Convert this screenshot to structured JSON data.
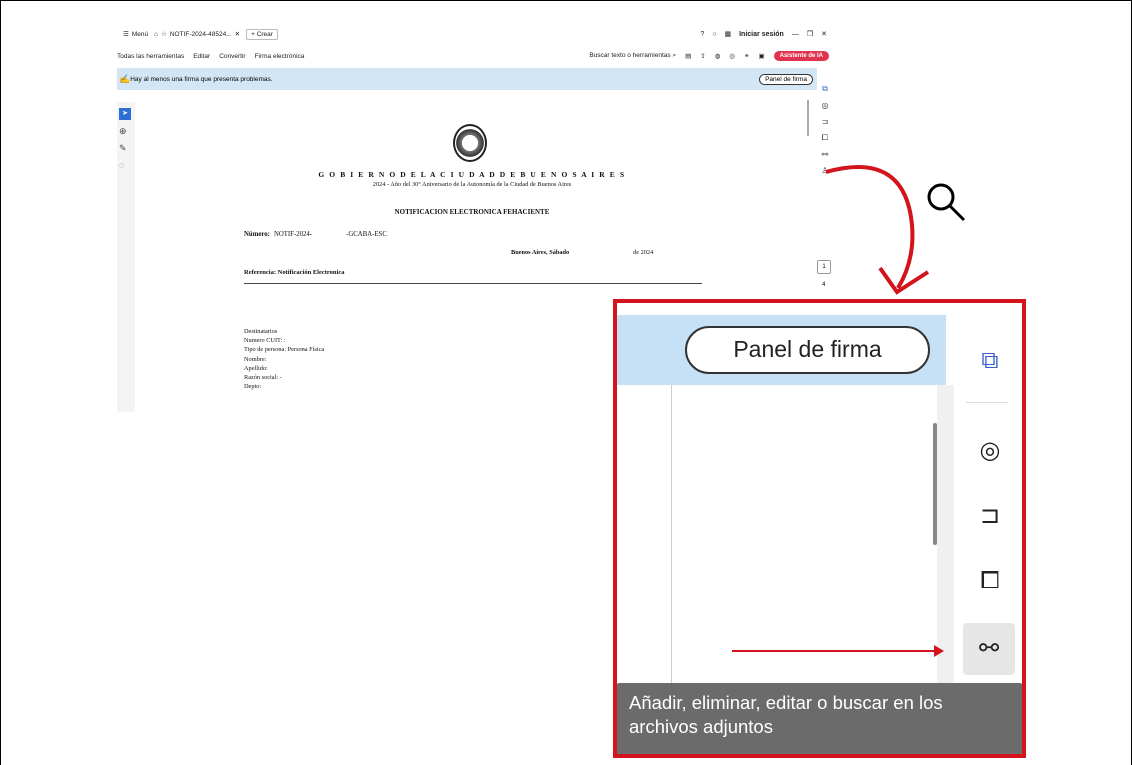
{
  "toolbar": {
    "menu_label": "Menú",
    "tab_title": "NOTIF-2024-48524...",
    "new_tab": "+ Crear",
    "login": "Iniciar sesión"
  },
  "menubar": {
    "items": [
      "Todas las herramientas",
      "Editar",
      "Convertir",
      "Firma electrónica"
    ],
    "search": "Buscar texto o herramientas",
    "ai_button": "Asistente de IA"
  },
  "banner": {
    "message": "Hay al menos una firma que presenta problemas.",
    "panel_button": "Panel de firma"
  },
  "document": {
    "gov_title": "G O B I E R N O D E L A C I U D A D D E B U E N O S A I R E S",
    "anniversary": "2024 - Año del 30° Aniversario de la Autonomía de la Ciudad de Buenos Aires",
    "notif_title": "NOTIFICACION ELECTRONICA FEHACIENTE",
    "numero_label": "Número:",
    "numero_code": "NOTIF-2024-",
    "numero_code2": "-GCABA-ESC",
    "place": "Buenos Aires, Sábado",
    "year": "de 2024",
    "reference": "Referencia: Notificación Electronica",
    "destinatarios": [
      "Destinatarios",
      "Numero CUIT: :",
      "Tipo de persona: Persona Física",
      "Nombre:",
      "Apellido:",
      "Razón social: -",
      "Depto:"
    ]
  },
  "page": {
    "current": "1",
    "total": "4"
  },
  "zoom": {
    "panel_label": "Panel de firma",
    "tooltip": "Añadir, eliminar, editar o buscar en los archivos adjuntos"
  },
  "colors": {
    "highlight": "#d4141c",
    "banner": "#d3e6f5",
    "ai": "#e0334f"
  }
}
